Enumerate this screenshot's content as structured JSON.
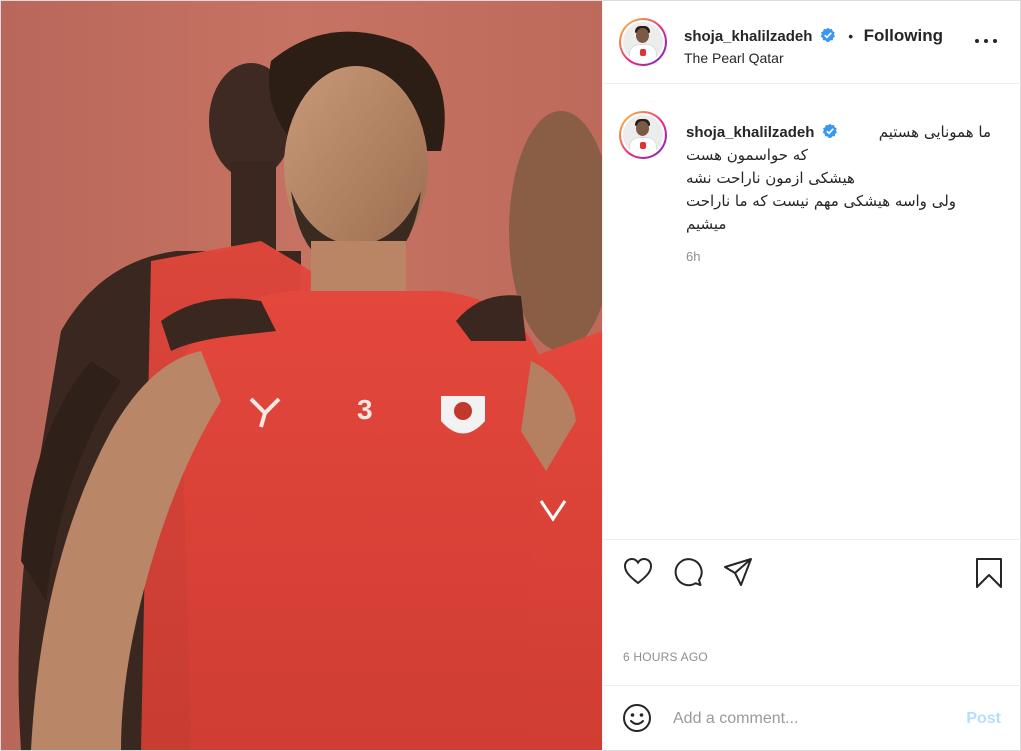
{
  "post": {
    "username": "shoja_khalilzadeh",
    "verified": true,
    "separator": "•",
    "follow_state": "Following",
    "location": "The Pearl Qatar",
    "more_icon": "more-horizontal-icon"
  },
  "photo": {
    "jersey_number": "3",
    "description_icon": "photo"
  },
  "caption": {
    "username": "shoja_khalilzadeh",
    "lines": [
      "ما همونایی هستیم",
      "که حواسمون هست",
      "هیشکی ازمون ناراحت نشه",
      "ولی واسه هیشکی مهم نیست که ما ناراحت",
      "میشیم"
    ],
    "relative_time": "6h"
  },
  "actions": {
    "icons": [
      "heart-icon",
      "comment-icon",
      "share-icon",
      "bookmark-icon"
    ],
    "timestamp": "6 HOURS AGO"
  },
  "comment": {
    "placeholder": "Add a comment...",
    "post_label": "Post",
    "emoji_icon": "emoji-icon"
  },
  "colors": {
    "verified": "#3897f0",
    "post_button_disabled": "#b2dffc",
    "jersey_red": "#e0483c",
    "background_wall": "#c36f60"
  }
}
